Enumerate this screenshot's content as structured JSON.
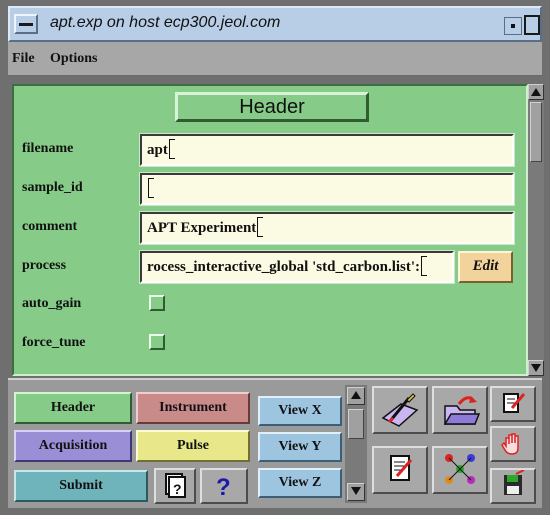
{
  "window": {
    "title": "apt.exp on host ecp300.jeol.com"
  },
  "menubar": {
    "file": "File",
    "options": "Options"
  },
  "form": {
    "section_button": "Header",
    "fields": {
      "filename": {
        "label": "filename",
        "value": "apt"
      },
      "sample_id": {
        "label": "sample_id",
        "value": ""
      },
      "comment": {
        "label": "comment",
        "value": "APT Experiment"
      },
      "process": {
        "label": "process",
        "value": "rocess_interactive_global 'std_carbon.list':"
      }
    },
    "edit_button": "Edit",
    "auto_gain": {
      "label": "auto_gain",
      "checked": false
    },
    "force_tune": {
      "label": "force_tune",
      "checked": false
    }
  },
  "bottom": {
    "header": "Header",
    "instrument": "Instrument",
    "acquisition": "Acquisition",
    "pulse": "Pulse",
    "submit": "Submit",
    "view_x": "View X",
    "view_y": "View Y",
    "view_z": "View Z",
    "icons": [
      "help-book-icon",
      "help-question-icon",
      "open-pen-icon",
      "open-folder-icon",
      "edit-doc-icon",
      "network-icon",
      "export-icon",
      "hand-icon",
      "save-disk-icon"
    ]
  },
  "colors": {
    "form_bg": "#86cc88",
    "title_bg": "#b8cde6",
    "header_btn": "#86cc88",
    "instrument_btn": "#c98a8a",
    "acquisition_btn": "#9a8fd6",
    "pulse_btn": "#e8e88a",
    "submit_btn": "#6fb3bb",
    "view_btn": "#9ec5df",
    "edit_btn": "#f1d39b"
  }
}
